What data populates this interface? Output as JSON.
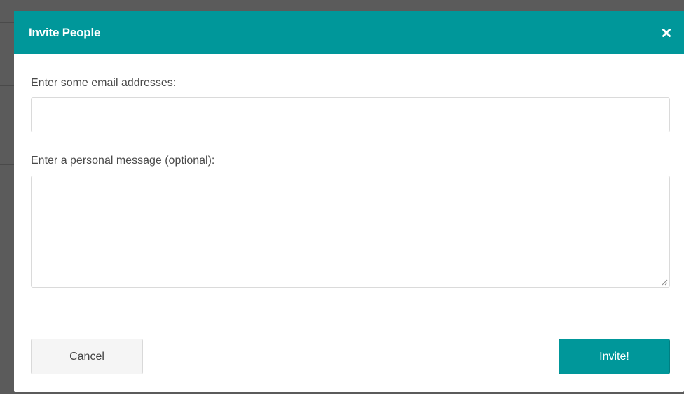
{
  "dialog": {
    "title": "Invite People",
    "close_icon": "close-icon"
  },
  "form": {
    "email_label": "Enter some email addresses:",
    "email_value": "",
    "email_placeholder": "",
    "message_label": "Enter a personal message (optional):",
    "message_value": "",
    "message_placeholder": ""
  },
  "actions": {
    "cancel_label": "Cancel",
    "invite_label": "Invite!"
  },
  "colors": {
    "accent": "#00979a",
    "backdrop": "#595959"
  }
}
